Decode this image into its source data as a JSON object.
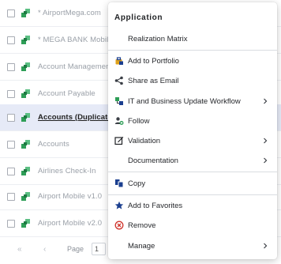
{
  "list": {
    "rows": [
      {
        "label": "* AirportMega.com",
        "selected": false
      },
      {
        "label": "* MEGA BANK Mobile",
        "selected": false
      },
      {
        "label": "Account Management",
        "selected": false
      },
      {
        "label": "Account Payable",
        "selected": false
      },
      {
        "label": "Accounts (Duplicate)",
        "selected": true
      },
      {
        "label": "Accounts",
        "selected": false
      },
      {
        "label": "Airlines Check-In",
        "selected": false
      },
      {
        "label": "Airport Mobile v1.0",
        "selected": false
      },
      {
        "label": "Airport Mobile v2.0",
        "selected": false
      }
    ]
  },
  "pager": {
    "first": "«",
    "prev": "‹",
    "page_label": "Page",
    "page_value": "1"
  },
  "menu": {
    "header": "Application",
    "items": [
      {
        "id": "realization-matrix",
        "label": "Realization Matrix",
        "icon": "none",
        "submenu": false
      },
      {
        "id": "add-to-portfolio",
        "label": "Add to Portfolio",
        "icon": "briefcase-lock-icon",
        "submenu": false
      },
      {
        "id": "share-as-email",
        "label": "Share as Email",
        "icon": "share-icon",
        "submenu": false
      },
      {
        "id": "it-business-update-workflow",
        "label": "IT and Business Update Workflow",
        "icon": "workflow-icon",
        "submenu": true
      },
      {
        "id": "follow",
        "label": "Follow",
        "icon": "follow-icon",
        "submenu": false
      },
      {
        "id": "validation",
        "label": "Validation",
        "icon": "edit-check-icon",
        "submenu": true
      },
      {
        "id": "documentation",
        "label": "Documentation",
        "icon": "none",
        "submenu": true
      },
      {
        "id": "copy",
        "label": "Copy",
        "icon": "copy-icon",
        "submenu": false
      },
      {
        "id": "add-to-favorites",
        "label": "Add to Favorites",
        "icon": "star-icon",
        "submenu": false
      },
      {
        "id": "remove",
        "label": "Remove",
        "icon": "remove-icon",
        "submenu": false
      },
      {
        "id": "manage",
        "label": "Manage",
        "icon": "none",
        "submenu": true
      }
    ]
  },
  "colors": {
    "accent_blue": "#1b3f8f",
    "app_green": "#2e9e57",
    "remove_red": "#d0342c",
    "selected_row": "#e6eaf7"
  }
}
